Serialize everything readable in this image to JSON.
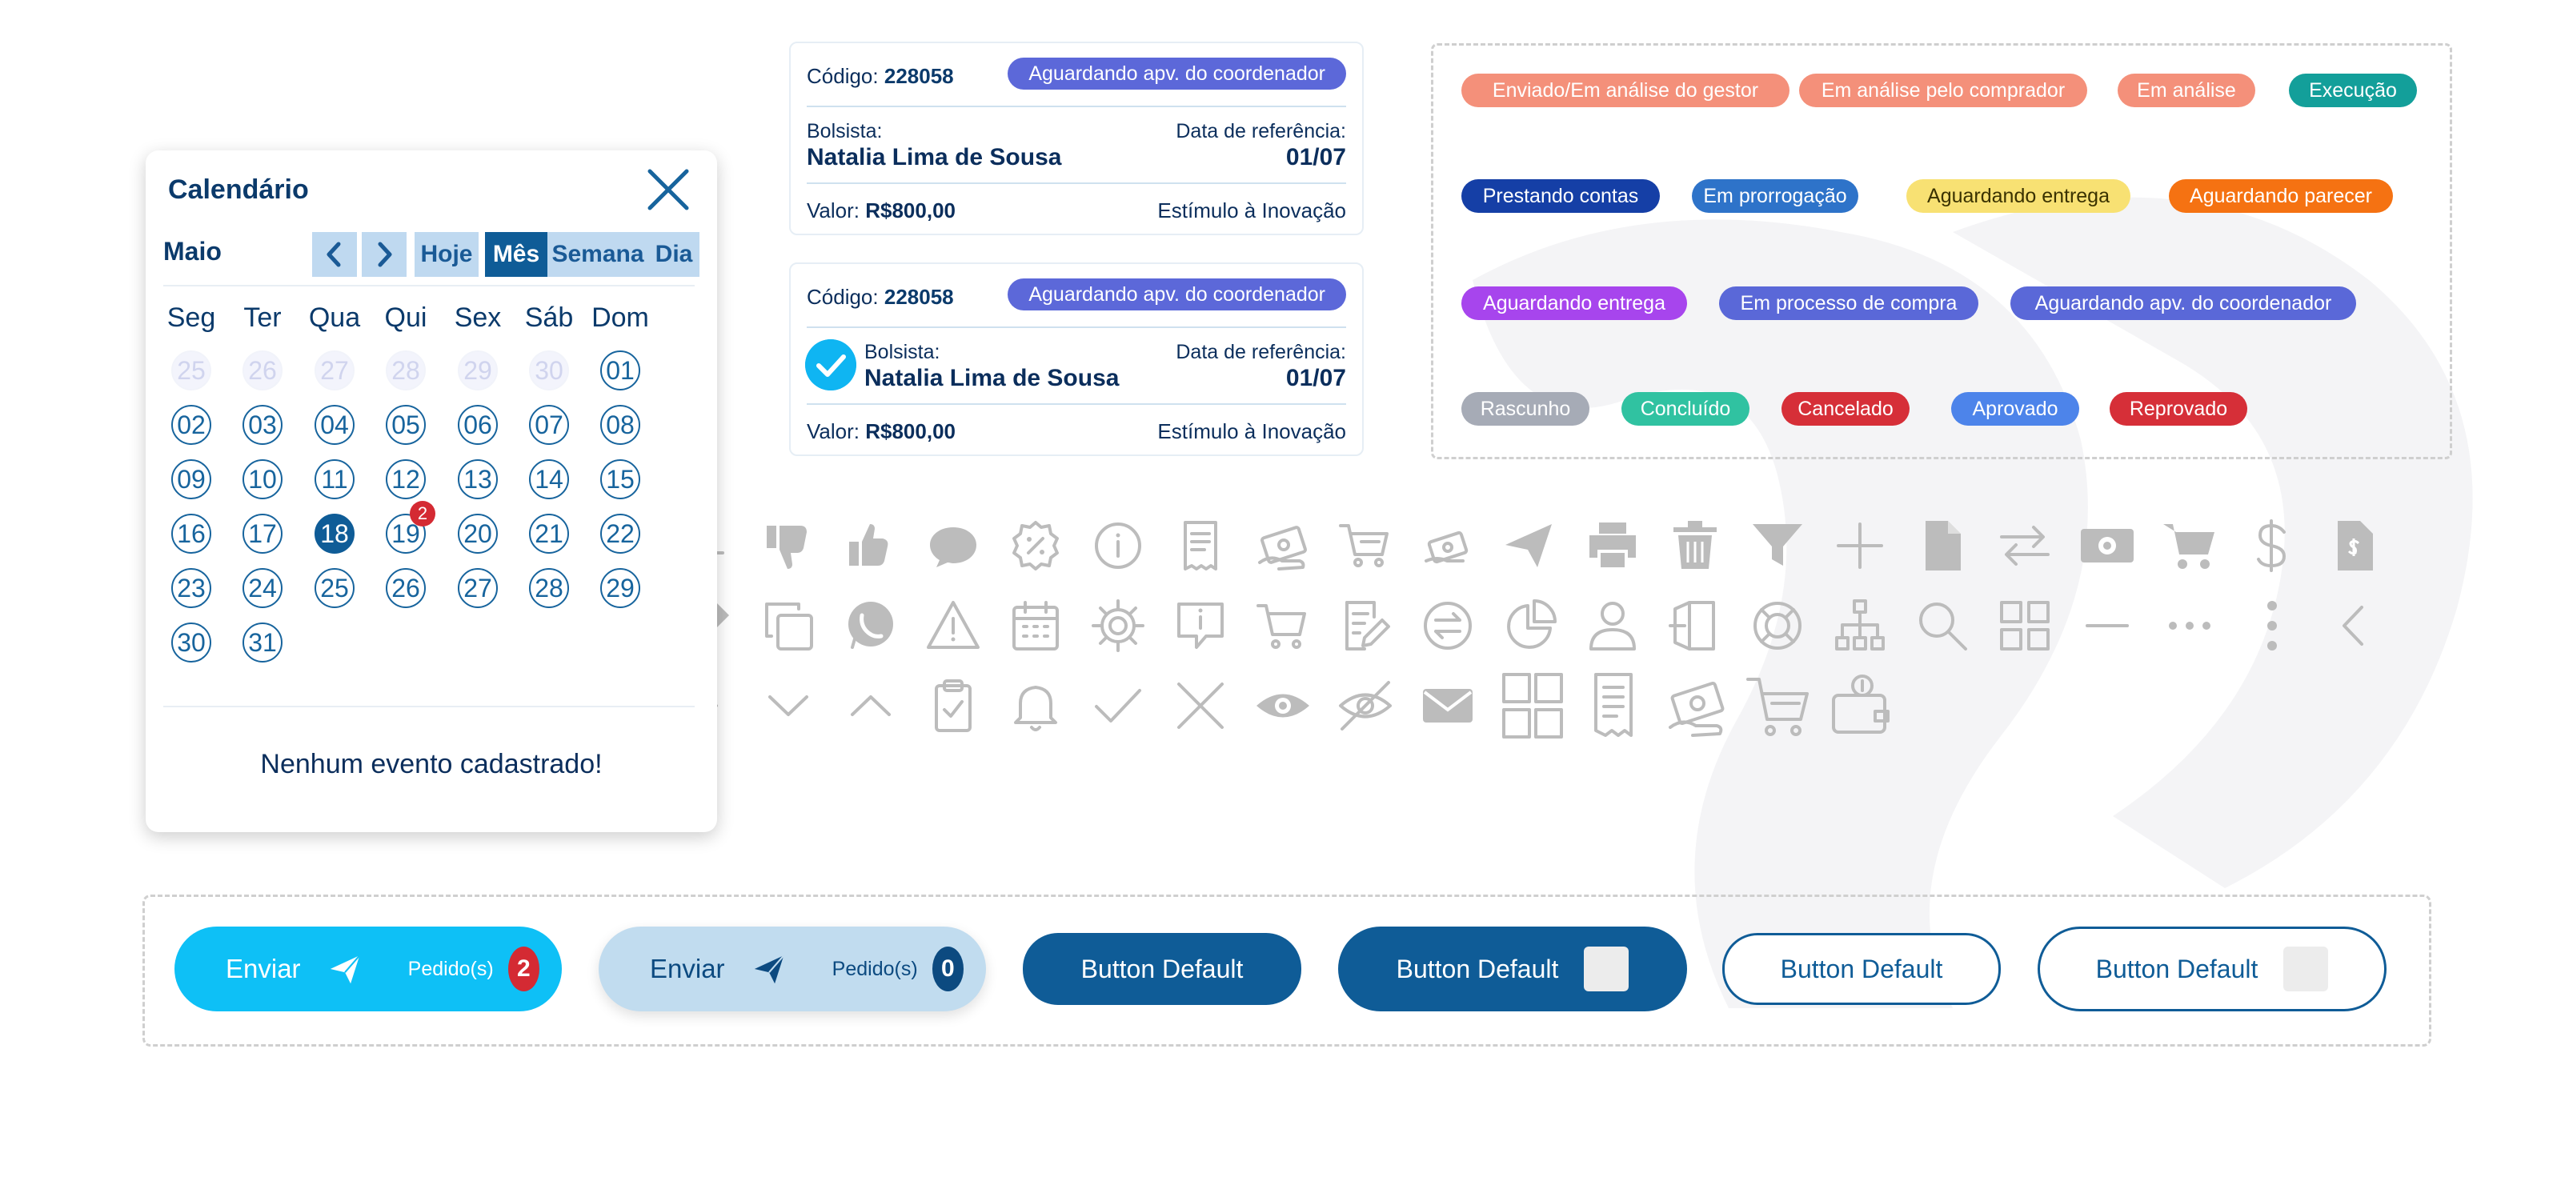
{
  "calendar": {
    "title": "Calendário",
    "month": "Maio",
    "nav": {
      "today": "Hoje",
      "month": "Mês",
      "week": "Semana",
      "day": "Dia",
      "active": "Mês"
    },
    "weekdays": [
      "Seg",
      "Ter",
      "Qua",
      "Qui",
      "Sex",
      "Sáb",
      "Dom"
    ],
    "weeks": [
      [
        "25",
        "26",
        "27",
        "28",
        "29",
        "30",
        "01"
      ],
      [
        "02",
        "03",
        "04",
        "05",
        "06",
        "07",
        "08"
      ],
      [
        "09",
        "10",
        "11",
        "12",
        "13",
        "14",
        "15"
      ],
      [
        "16",
        "17",
        "18",
        "19",
        "20",
        "21",
        "22"
      ],
      [
        "23",
        "24",
        "25",
        "26",
        "27",
        "28",
        "29"
      ],
      [
        "30",
        "31"
      ]
    ],
    "outside_month_days": [
      "25",
      "26",
      "27",
      "28",
      "29",
      "30"
    ],
    "selected_day": "18",
    "event_badge": {
      "day": "19",
      "count": "2"
    },
    "empty_message": "Nenhum evento cadastrado!"
  },
  "cards": [
    {
      "code_label": "Código:",
      "code": "228058",
      "status": "Aguardando apv. do coordenador",
      "holder_label": "Bolsista:",
      "holder": "Natalia Lima de Sousa",
      "ref_label": "Data de referência:",
      "ref_date": "01/07",
      "value_label": "Valor:",
      "value": "R$800,00",
      "program": "Estímulo à Inovação",
      "checked": false
    },
    {
      "code_label": "Código:",
      "code": "228058",
      "status": "Aguardando apv. do coordenador",
      "holder_label": "Bolsista:",
      "holder": "Natalia Lima de Sousa",
      "ref_label": "Data de referência:",
      "ref_date": "01/07",
      "value_label": "Valor:",
      "value": "R$800,00",
      "program": "Estímulo à Inovação",
      "checked": true
    }
  ],
  "status_tags": [
    {
      "label": "Enviado/Em análise do gestor",
      "color": "#f4907a"
    },
    {
      "label": "Em análise pelo comprador",
      "color": "#f4907a"
    },
    {
      "label": "Em análise",
      "color": "#f4907a"
    },
    {
      "label": "Execução",
      "color": "#139f9a"
    },
    {
      "label": "Prestando contas",
      "color": "#153fa6"
    },
    {
      "label": "Em prorrogação",
      "color": "#2e73c9"
    },
    {
      "label": "Aguardando entrega",
      "color": "#f8e173"
    },
    {
      "label": "Aguardando parecer",
      "color": "#f57212"
    },
    {
      "label": "Aguardando entrega",
      "color": "#a745ed"
    },
    {
      "label": "Em processo de compra",
      "color": "#5a68d8"
    },
    {
      "label": "Aguardando apv. do coordenador",
      "color": "#5a68d8"
    },
    {
      "label": "Rascunho",
      "color": "#a6abb6"
    },
    {
      "label": "Concluído",
      "color": "#30c2a1"
    },
    {
      "label": "Cancelado",
      "color": "#d62f38"
    },
    {
      "label": "Aprovado",
      "color": "#4d84ea"
    },
    {
      "label": "Reprovado",
      "color": "#d62f38"
    }
  ],
  "icons": [
    "download-icon",
    "thumbs-down-icon",
    "thumbs-up-icon",
    "chat-bubble-icon",
    "percent-badge-icon",
    "info-icon",
    "receipt-icon",
    "money-hand-icon",
    "shopping-cart-outline-icon",
    "money-hand-small-icon",
    "send-icon",
    "printer-icon",
    "trash-icon",
    "filter-icon",
    "plus-icon",
    "file-icon",
    "transfer-icon",
    "cash-icon",
    "shopping-cart-icon",
    "dollar-icon",
    "invoice-icon",
    "edit-pencil-icon",
    "copy-icon",
    "whatsapp-icon",
    "warning-icon",
    "calendar-icon",
    "gear-icon",
    "chat-info-icon",
    "cart-outline-icon",
    "edit-document-icon",
    "exchange-circle-icon",
    "pie-chart-icon",
    "user-icon",
    "logout-icon",
    "lifebuoy-icon",
    "org-chart-icon",
    "search-icon",
    "grid-icon",
    "minus-icon",
    "more-horizontal-icon",
    "more-vertical-icon",
    "chevron-left-icon",
    "chevron-right-icon",
    "chevron-down-icon",
    "chevron-up-icon",
    "clipboard-check-icon",
    "bell-icon",
    "check-icon",
    "close-icon",
    "eye-icon",
    "eye-off-icon",
    "mail-icon",
    "grid-large-icon",
    "receipt-large-icon",
    "money-hand-large-icon",
    "cart-large-icon",
    "wallet-icon"
  ],
  "buttons": [
    {
      "type": "send",
      "label": "Enviar",
      "sub_label": "Pedido(s)",
      "count": "2",
      "bg": "#0ec0f6",
      "count_bg": "#d42a33"
    },
    {
      "type": "send",
      "label": "Enviar",
      "sub_label": "Pedido(s)",
      "count": "0",
      "bg": "#c1dcef",
      "count_bg": "#0c4a80"
    },
    {
      "type": "default-filled",
      "label": "Button Default"
    },
    {
      "type": "default-filled-icon",
      "label": "Button Default"
    },
    {
      "type": "default-outline",
      "label": "Button Default"
    },
    {
      "type": "default-outline-icon",
      "label": "Button Default"
    }
  ],
  "colors": {
    "primary": "#0f5c97",
    "primary_light": "#bfd9f0",
    "icon_gray": "#bcbcbc",
    "accent_cyan": "#0ec0f6",
    "badge_red": "#d42a33"
  }
}
